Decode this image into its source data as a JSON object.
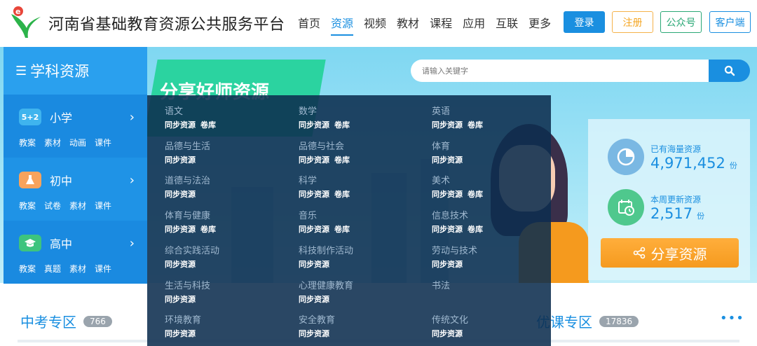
{
  "header": {
    "title": "河南省基础教育资源公共服务平台",
    "nav": [
      "首页",
      "资源",
      "视频",
      "教材",
      "课程",
      "应用",
      "互联",
      "更多"
    ],
    "active_nav": "资源",
    "login": "登录",
    "register": "注册",
    "wechat": "公众号",
    "client": "客户端"
  },
  "search": {
    "placeholder": "请输入关键字"
  },
  "banner": {
    "slogan": "分享好师资源"
  },
  "sidebar": {
    "title": "学科资源",
    "stages": [
      {
        "name": "小学",
        "badge": "5+2",
        "color": "#3fb4ee",
        "links": [
          "教案",
          "素材",
          "动画",
          "课件"
        ]
      },
      {
        "name": "初中",
        "badge": "flask",
        "color": "#f7a35c",
        "links": [
          "教案",
          "试卷",
          "素材",
          "课件"
        ]
      },
      {
        "name": "高中",
        "badge": "cap",
        "color": "#3dc47e",
        "links": [
          "教案",
          "真题",
          "素材",
          "课件"
        ]
      }
    ]
  },
  "subjects": [
    {
      "name": "语文",
      "links": [
        "同步资源",
        "卷库"
      ]
    },
    {
      "name": "数学",
      "links": [
        "同步资源",
        "卷库"
      ]
    },
    {
      "name": "英语",
      "links": [
        "同步资源",
        "卷库"
      ]
    },
    {
      "name": "品德与生活",
      "links": [
        "同步资源"
      ]
    },
    {
      "name": "品德与社会",
      "links": [
        "同步资源",
        "卷库"
      ]
    },
    {
      "name": "体育",
      "links": [
        "同步资源"
      ]
    },
    {
      "name": "道德与法治",
      "links": [
        "同步资源"
      ]
    },
    {
      "name": "科学",
      "links": [
        "同步资源",
        "卷库"
      ]
    },
    {
      "name": "美术",
      "links": [
        "同步资源",
        "卷库"
      ]
    },
    {
      "name": "体育与健康",
      "links": [
        "同步资源",
        "卷库"
      ]
    },
    {
      "name": "音乐",
      "links": [
        "同步资源",
        "卷库"
      ]
    },
    {
      "name": "信息技术",
      "links": [
        "同步资源",
        "卷库"
      ]
    },
    {
      "name": "综合实践活动",
      "links": [
        "同步资源"
      ]
    },
    {
      "name": "科技制作活动",
      "links": [
        "同步资源"
      ]
    },
    {
      "name": "劳动与技术",
      "links": [
        "同步资源"
      ]
    },
    {
      "name": "生活与科技",
      "links": [
        "同步资源"
      ]
    },
    {
      "name": "心理健康教育",
      "links": [
        "同步资源"
      ]
    },
    {
      "name": "书法",
      "links": []
    },
    {
      "name": "环境教育",
      "links": [
        "同步资源"
      ]
    },
    {
      "name": "安全教育",
      "links": [
        "同步资源"
      ]
    },
    {
      "name": "传统文化",
      "links": [
        "同步资源"
      ]
    }
  ],
  "stats": {
    "total_label": "已有海量资源",
    "total_value": "4,971,452",
    "total_unit": "份",
    "weekly_label": "本周更新资源",
    "weekly_value": "2,517",
    "weekly_unit": "份",
    "share_button": "分享资源"
  },
  "zones": [
    {
      "title": "中考专区",
      "count": "766"
    },
    {
      "title": "优课专区",
      "count": "17836"
    }
  ],
  "zone_more": "•••",
  "colors": {
    "primary": "#1a8fe0",
    "orange": "#f59a1e",
    "green": "#2aa876"
  }
}
